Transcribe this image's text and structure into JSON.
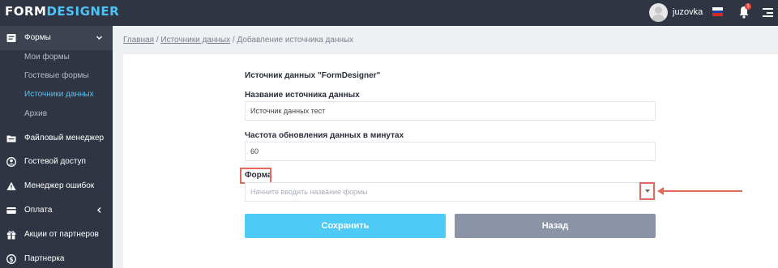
{
  "app": {
    "logo_part1": "FORM",
    "logo_part2": "DESIGNER"
  },
  "header": {
    "username": "juzovka",
    "notifications_count": "1",
    "flag": [
      "#ffffff",
      "#1c3fae",
      "#d52b1e"
    ]
  },
  "sidebar": {
    "items": [
      {
        "label": "Формы",
        "icon": "forms-icon"
      },
      {
        "label": "Файловый менеджер",
        "icon": "file-manager-icon"
      },
      {
        "label": "Гостевой доступ",
        "icon": "guest-access-icon"
      },
      {
        "label": "Менеджер ошибок",
        "icon": "warning-icon"
      },
      {
        "label": "Оплата",
        "icon": "payment-card-icon"
      },
      {
        "label": "Акции от партнеров",
        "icon": "gift-icon"
      },
      {
        "label": "Партнерка",
        "icon": "dollar-icon"
      }
    ],
    "subitems": [
      {
        "label": "Мои формы"
      },
      {
        "label": "Гостевые формы"
      },
      {
        "label": "Источники данных"
      },
      {
        "label": "Архив"
      }
    ]
  },
  "breadcrumb": {
    "home": "Главная",
    "separator": " / ",
    "section": "Источники данных",
    "current": "Добавление источника данных"
  },
  "form": {
    "title": "Источник данных \"FormDesigner\"",
    "name_label": "Название источника данных",
    "name_value": "Источник данных тест",
    "frequency_label": "Частота обновления данных в минутах",
    "frequency_value": "60",
    "form_label": "Форма",
    "form_placeholder": "Начните вводить название формы",
    "save_label": "Сохранить",
    "back_label": "Назад"
  },
  "colors": {
    "accent": "#4fc3f7",
    "sidebar_bg": "#2f3542",
    "save_button": "#4dcaf5",
    "back_button": "#8a94a6",
    "annotation": "#e06b5c"
  }
}
